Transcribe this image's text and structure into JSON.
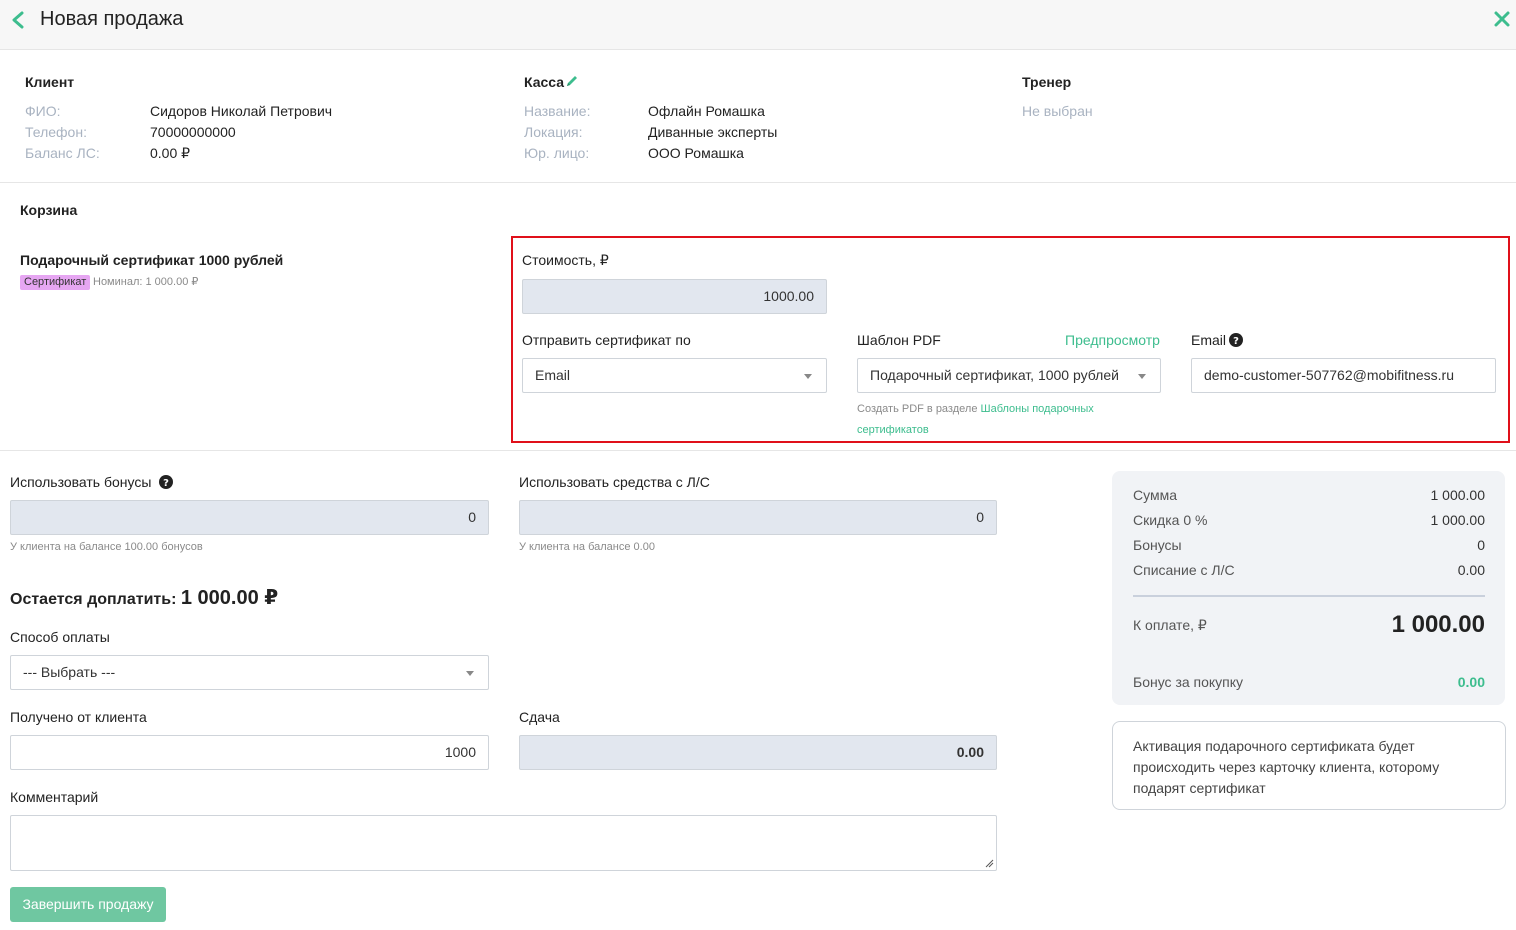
{
  "header": {
    "title": "Новая продажа"
  },
  "client": {
    "title": "Клиент",
    "fio_label": "ФИО:",
    "fio": "Сидоров Николай Петрович",
    "phone_label": "Телефон:",
    "phone": "70000000000",
    "balance_label": "Баланс ЛС:",
    "balance": "0.00 ₽"
  },
  "kassa": {
    "title": "Касса",
    "name_label": "Название:",
    "name": "Офлайн Ромашка",
    "location_label": "Локация:",
    "location": "Диванные эксперты",
    "entity_label": "Юр. лицо:",
    "entity": "ООО Ромашка"
  },
  "trainer": {
    "title": "Тренер",
    "value": "Не выбран"
  },
  "cart": {
    "title": "Корзина",
    "item_name": "Подарочный сертификат 1000 рублей",
    "badge": "Сертификат",
    "nominal": "Номинал: 1 000.00 ₽"
  },
  "certificate": {
    "cost_label": "Стоимость, ₽",
    "cost_value": "1000.00",
    "send_label": "Отправить сертификат по",
    "send_value": "Email",
    "template_label": "Шаблон PDF",
    "preview_link": "Предпросмотр",
    "template_value": "Подарочный сертификат, 1000 рублей",
    "hint_prefix": "Создать PDF в разделе",
    "hint_link_1": "Шаблоны подарочных",
    "hint_link_2": "сертификатов",
    "email_label": "Email",
    "email_value": "demo-customer-507762@mobifitness.ru"
  },
  "payment": {
    "bonus_label": "Использовать бонусы",
    "bonus_value": "0",
    "bonus_hint": "У клиента на балансе 100.00 бонусов",
    "account_label": "Использовать средства с Л/С",
    "account_value": "0",
    "account_hint": "У клиента на балансе 0.00",
    "remaining_label": "Остается доплатить:",
    "remaining_amount": "1 000.00 ₽",
    "method_label": "Способ оплаты",
    "method_value": "--- Выбрать ---",
    "received_label": "Получено от клиента",
    "received_value": "1000",
    "change_label": "Сдача",
    "change_value": "0.00",
    "comment_label": "Комментарий",
    "submit": "Завершить продажу"
  },
  "summary": {
    "sum_label": "Сумма",
    "sum_value": "1 000.00",
    "discount_label": "Скидка 0 %",
    "discount_value": "1 000.00",
    "bonus_label": "Бонусы",
    "bonus_value": "0",
    "writeoff_label": "Списание с Л/С",
    "writeoff_value": "0.00",
    "total_label": "К оплате, ₽",
    "total_value": "1 000.00",
    "purchase_bonus_label": "Бонус за покупку",
    "purchase_bonus_value": "0.00"
  },
  "note": {
    "text": "Активация подарочного сертификата будет происходить через карточку клиента, которому подарят сертификат"
  },
  "colors": {
    "accent": "#3dbd8e",
    "highlight": "#e0101a",
    "badge": "#e6a6f2",
    "disabled_input": "#e2e7ef"
  }
}
